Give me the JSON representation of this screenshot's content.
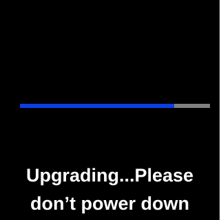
{
  "screen": {
    "background_color": "#000000"
  },
  "progress": {
    "value_percent": 81,
    "fill_color": "#0b3fe4",
    "track_color": "#808080"
  },
  "message": {
    "line1": "Upgrading...Please",
    "line2": "don’t power down",
    "text_color": "#ffffff"
  }
}
